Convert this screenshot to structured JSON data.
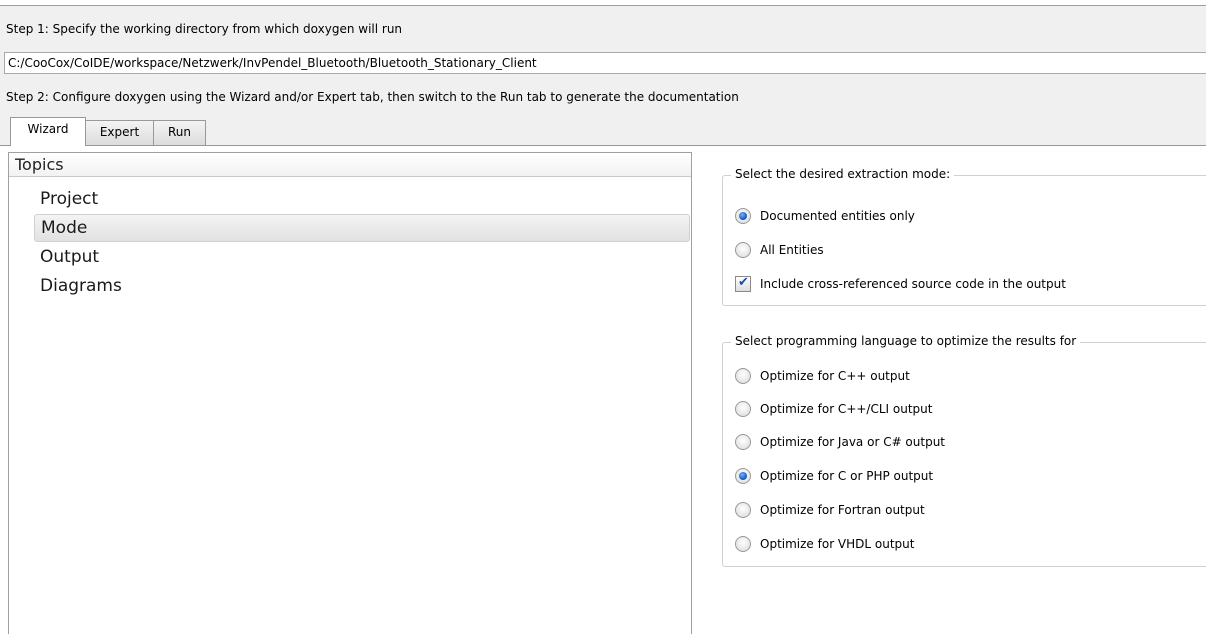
{
  "step1": {
    "label": "Step 1: Specify the working directory from which doxygen will run"
  },
  "working_directory": {
    "value": "C:/CooCox/CoIDE/workspace/Netzwerk/InvPendel_Bluetooth/Bluetooth_Stationary_Client"
  },
  "step2": {
    "label": "Step 2: Configure doxygen using the Wizard and/or Expert tab, then switch to the Run tab to generate the documentation"
  },
  "tabs": [
    {
      "label": "Wizard",
      "active": true
    },
    {
      "label": "Expert",
      "active": false
    },
    {
      "label": "Run",
      "active": false
    }
  ],
  "topics": {
    "header": "Topics",
    "items": [
      {
        "label": "Project",
        "selected": false
      },
      {
        "label": "Mode",
        "selected": true
      },
      {
        "label": "Output",
        "selected": false
      },
      {
        "label": "Diagrams",
        "selected": false
      }
    ]
  },
  "mode_group": {
    "title": "Select the desired extraction mode:",
    "options": [
      {
        "label": "Documented entities only",
        "checked": true
      },
      {
        "label": "All Entities",
        "checked": false
      }
    ],
    "cross_ref": {
      "label": "Include cross-referenced source code in the output",
      "checked": true
    }
  },
  "language_group": {
    "title": "Select programming language to optimize the results for",
    "options": [
      {
        "label": "Optimize for C++ output",
        "checked": false
      },
      {
        "label": "Optimize for C++/CLI output",
        "checked": false
      },
      {
        "label": "Optimize for Java or C# output",
        "checked": false
      },
      {
        "label": "Optimize for C or PHP output",
        "checked": true
      },
      {
        "label": "Optimize for Fortran output",
        "checked": false
      },
      {
        "label": "Optimize for VHDL output",
        "checked": false
      }
    ]
  },
  "colors": {
    "accent": "#1b5fc6",
    "check": "#1f4fa8",
    "border": "#a0a0a0"
  }
}
